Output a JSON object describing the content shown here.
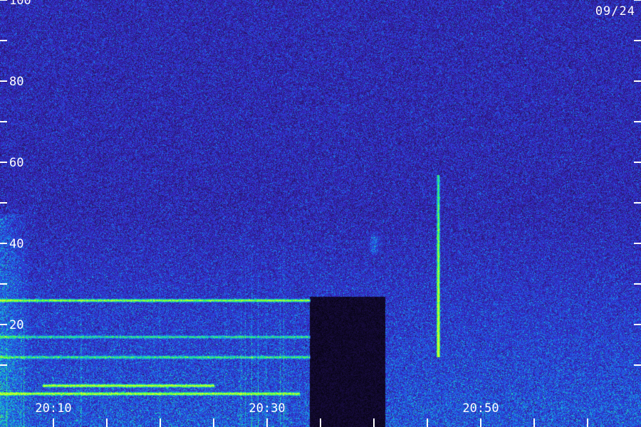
{
  "date_label": "09/24",
  "chart_data": {
    "type": "heatmap",
    "title": "",
    "xlabel": "",
    "ylabel": "",
    "x_tick_labels": [
      "20:10",
      "20:30",
      "20:50"
    ],
    "y_tick_labels": [
      "100",
      "80",
      "60",
      "40",
      "20"
    ],
    "y_major_ticks": [
      100,
      80,
      60,
      40,
      20
    ],
    "y_minor_ticks": [
      90,
      70,
      50,
      30,
      10
    ],
    "ylim": [
      0,
      100
    ],
    "xlim": [
      "20:05",
      "21:05"
    ],
    "x_minor_tick_step_minutes": 5,
    "colorscale": [
      "#000000",
      "#2a1670",
      "#3828c8",
      "#1e5ae6",
      "#18a8e8",
      "#20e0a0",
      "#40ff40",
      "#c8ff30"
    ],
    "features": {
      "horizontal_lines": [
        {
          "y": 26,
          "x_start": "20:05",
          "x_end": "20:34",
          "intensity": 0.85
        },
        {
          "y": 3,
          "x_start": "20:05",
          "x_end": "20:33",
          "intensity": 0.9
        },
        {
          "y": 5,
          "x_start": "20:09",
          "x_end": "20:25",
          "intensity": 0.95
        },
        {
          "y": 12,
          "x_start": "20:05",
          "x_end": "20:34",
          "intensity": 0.55
        },
        {
          "y": 17,
          "x_start": "20:05",
          "x_end": "20:34",
          "intensity": 0.5
        }
      ],
      "quiet_block": {
        "x_start": "20:34",
        "x_end": "20:41",
        "y_min": 0,
        "y_max": 27
      },
      "vertical_burst": {
        "x": "20:46",
        "y_min": 12,
        "y_max": 57
      },
      "diffuse_patch": {
        "x": "20:40",
        "y": 40
      },
      "left_noise_band_x_end": "20:08"
    }
  }
}
